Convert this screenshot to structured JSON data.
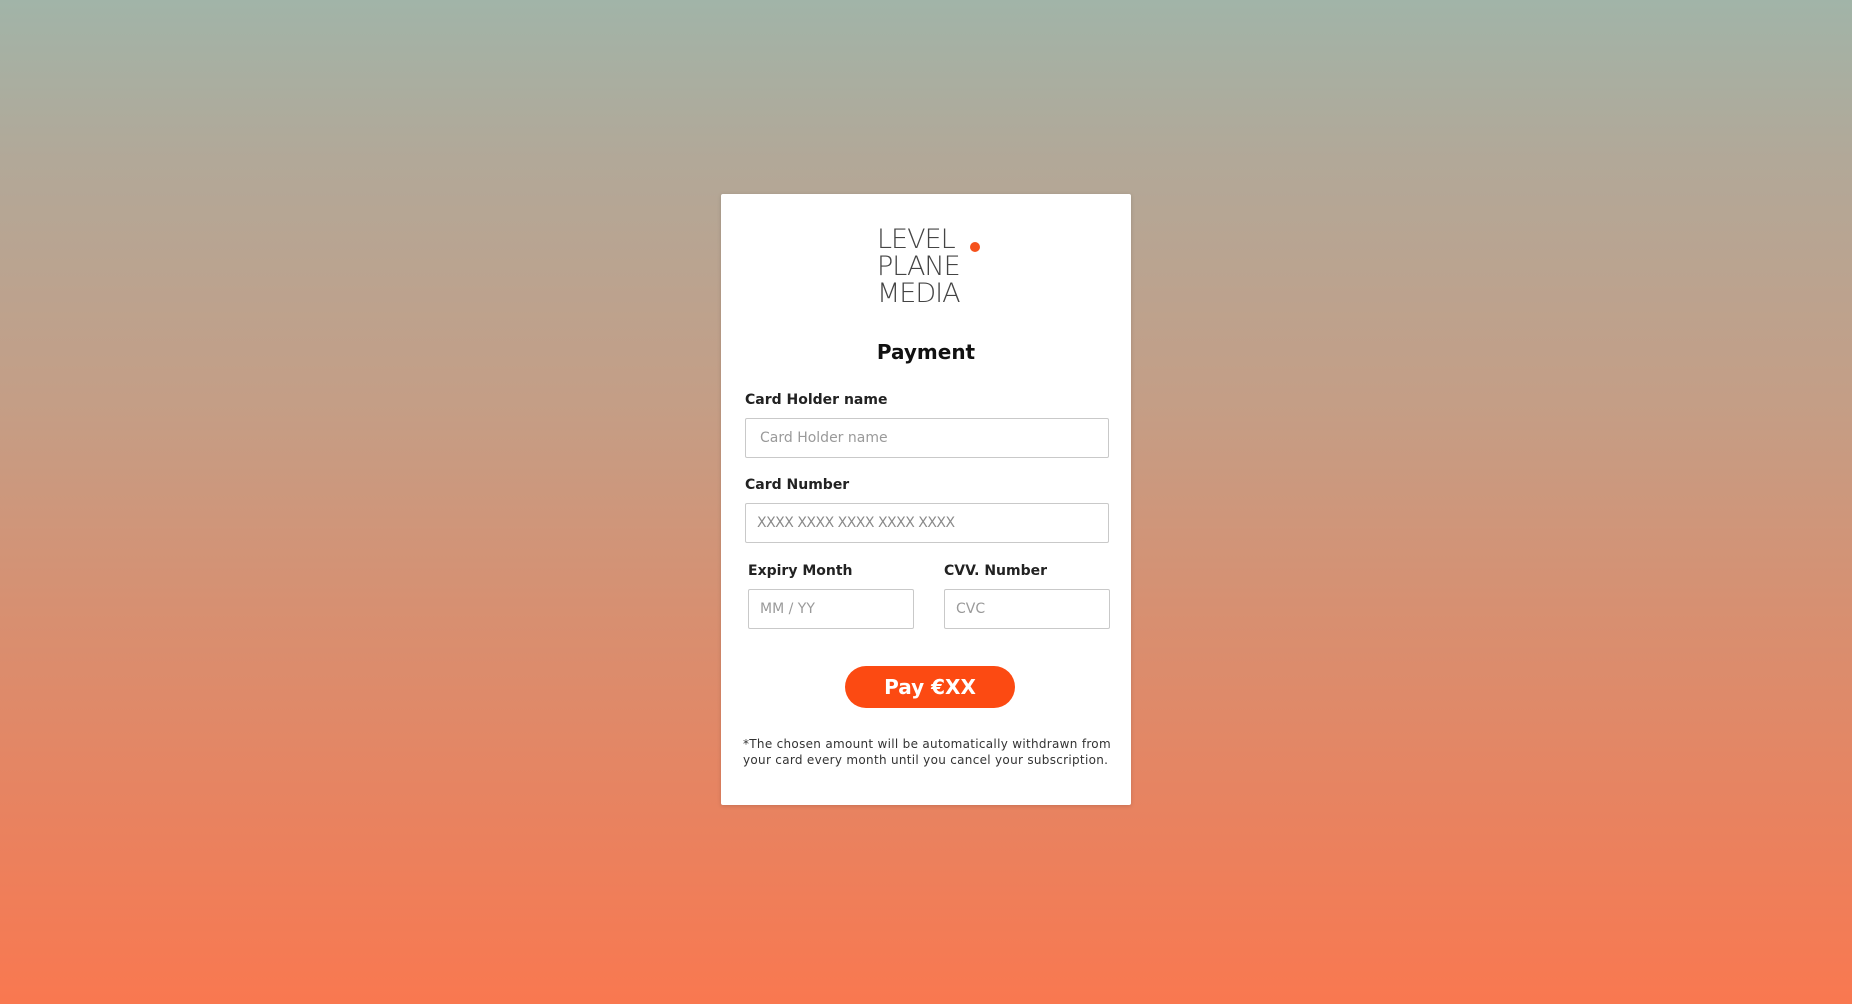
{
  "brand": {
    "logo_lines": [
      "LEVEL",
      "PLANE",
      "MEDIA"
    ],
    "accent_color": "#f5511c"
  },
  "form": {
    "title": "Payment",
    "card_holder": {
      "label": "Card Holder name",
      "placeholder": "Card Holder name",
      "value": ""
    },
    "card_number": {
      "label": "Card Number",
      "placeholder": "XXXX XXXX XXXX XXXX XXXX",
      "value": ""
    },
    "expiry": {
      "label": "Expiry Month",
      "placeholder": "MM / YY",
      "value": ""
    },
    "cvv": {
      "label": "CVV. Number",
      "placeholder": "CVC",
      "value": ""
    },
    "pay_button": "Pay €XX",
    "note": "*The chosen amount will be automatically withdrawn from your card every month until you cancel your subscription."
  },
  "colors": {
    "button": "#fc4a12",
    "background_top": "#a1b4a8",
    "background_bottom": "#f97850"
  }
}
